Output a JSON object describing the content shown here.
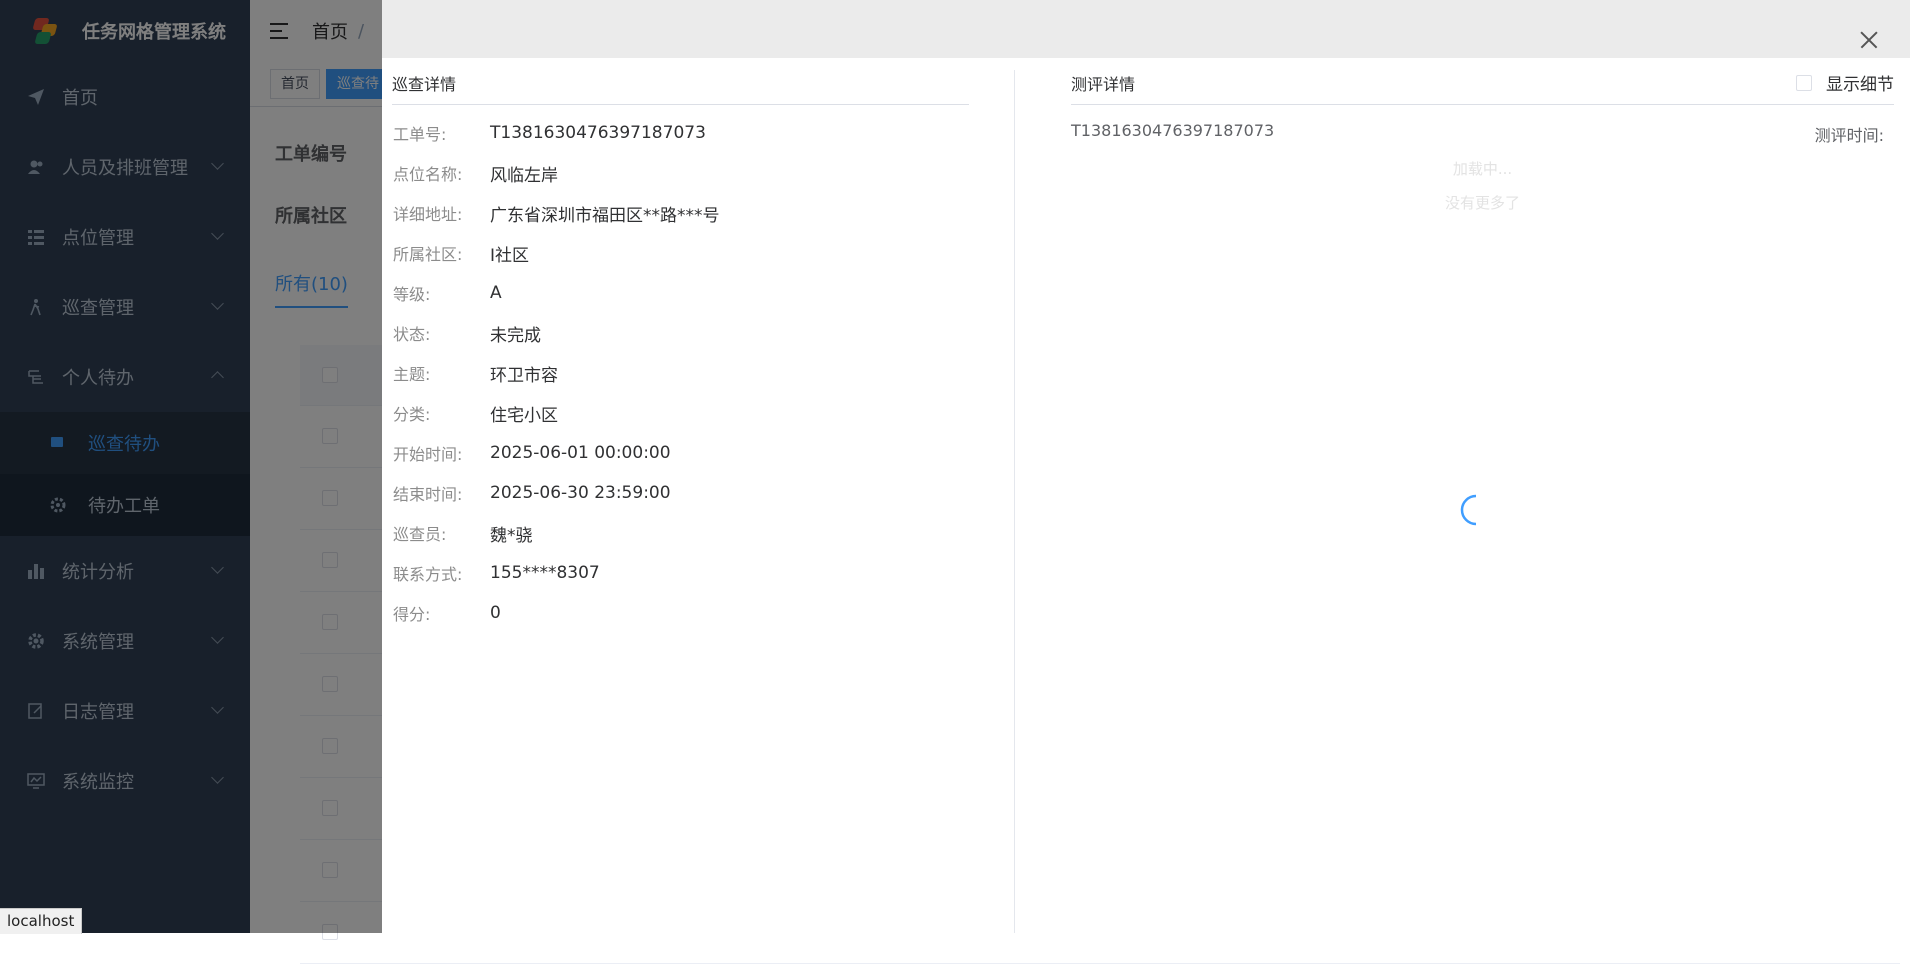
{
  "sidebar": {
    "title": "任务网格管理系统",
    "items": [
      {
        "label": "首页",
        "icon": "paper-plane-icon"
      },
      {
        "label": "人员及排班管理",
        "icon": "users-icon"
      },
      {
        "label": "点位管理",
        "icon": "list-icon"
      },
      {
        "label": "巡查管理",
        "icon": "walk-icon"
      },
      {
        "label": "个人待办",
        "icon": "inbox-icon"
      }
    ],
    "sub_items": [
      {
        "label": "巡查待办",
        "icon": "patrol-icon"
      },
      {
        "label": "待办工单",
        "icon": "gear-icon"
      }
    ],
    "bottom_items": [
      {
        "label": "统计分析",
        "icon": "chart-icon"
      },
      {
        "label": "系统管理",
        "icon": "settings-icon"
      },
      {
        "label": "日志管理",
        "icon": "edit-icon"
      },
      {
        "label": "系统监控",
        "icon": "monitor-icon"
      }
    ]
  },
  "navbar": {
    "breadcrumb_home": "首页",
    "breadcrumb_sep": "/"
  },
  "tags": {
    "home": "首页",
    "active": "巡查待"
  },
  "form": {
    "order_no_label": "工单编号",
    "community_label": "所属社区"
  },
  "tabs": {
    "all": "所有(10)"
  },
  "drawer": {
    "left_title": "巡查详情",
    "details": [
      {
        "label": "工单号:",
        "value": "T1381630476397187073"
      },
      {
        "label": "点位名称:",
        "value": "风临左岸"
      },
      {
        "label": "详细地址:",
        "value": "广东省深圳市福田区**路***号"
      },
      {
        "label": "所属社区:",
        "value": "I社区"
      },
      {
        "label": "等级:",
        "value": "A"
      },
      {
        "label": "状态:",
        "value": "未完成"
      },
      {
        "label": "主题:",
        "value": "环卫市容"
      },
      {
        "label": "分类:",
        "value": "住宅小区"
      },
      {
        "label": "开始时间:",
        "value": "2025-06-01 00:00:00"
      },
      {
        "label": "结束时间:",
        "value": "2025-06-30 23:59:00"
      },
      {
        "label": "巡查员:",
        "value": "魏*骁"
      },
      {
        "label": "联系方式:",
        "value": "155****8307"
      },
      {
        "label": "得分:",
        "value": "0"
      }
    ],
    "right_title": "测评详情",
    "show_detail_label": "显示细节",
    "eval_id": "T1381630476397187073",
    "eval_time_label": "测评时间:",
    "loading_text": "加载中...",
    "no_more_text": "没有更多了"
  },
  "status_tip": "localhost",
  "colors": {
    "sidebar_bg": "#304156",
    "accent": "#409eff",
    "mask": "rgba(0,0,0,0.5)"
  }
}
